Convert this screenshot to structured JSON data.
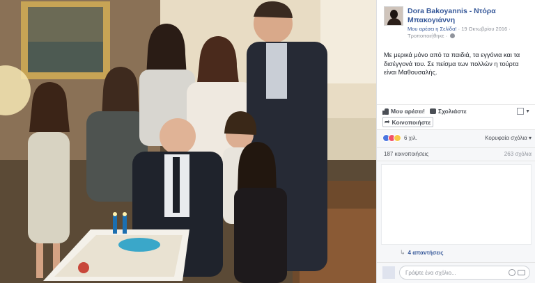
{
  "post": {
    "author": "Dora Bakoyannis - Ντόρα Μπακογιάννη",
    "liked_page": "Μου αρέσει η Σελίδα!",
    "date": "19 Οκτωβρίου 2016",
    "edited": "Τροποποιήθηκε",
    "text": "Με μερικά μόνο από τα παιδιά, τα εγγόνια και τα δισέγγονά του. Σε πείσμα των πολλών η τούρτα είναι Μαθουσαλής."
  },
  "actions": {
    "like": "Μου αρέσει!",
    "comment": "Σχολιάστε",
    "share": "Κοινοποιήστε"
  },
  "stats": {
    "reactions": "6 χιλ.",
    "top_comments": "Κορυφαία σχόλια",
    "shares": "187 κοινοποιήσεις",
    "comments": "263 σχόλια",
    "replies": "4 απαντήσεις"
  },
  "composer": {
    "placeholder": "Γράψτε ένα σχόλιο..."
  },
  "colors": {
    "link": "#365899",
    "text": "#1d2129",
    "muted": "#90949c",
    "like_blue": "#4a76e0",
    "love_red": "#f25268",
    "haha_yellow": "#f7c948"
  },
  "icons": [
    "like-icon",
    "comment-icon",
    "share-icon",
    "globe-icon",
    "emoji-icon",
    "camera-icon",
    "reply-arrow-icon"
  ]
}
